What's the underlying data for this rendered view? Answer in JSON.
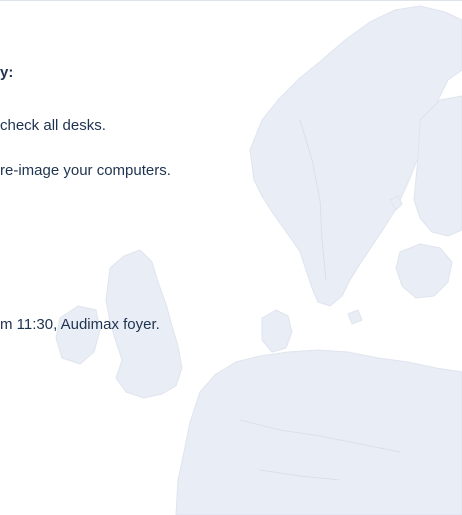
{
  "message": {
    "heading": "y:",
    "lines": [
      "check all desks.",
      "re-image your computers.",
      "m 11:30, Audimax foyer."
    ]
  },
  "colors": {
    "text": "#1e3350",
    "map_fill": "#e8ecf4",
    "map_stroke": "#dce2ec",
    "background": "#ffffff"
  },
  "icons": {
    "background": "europe-map-icon"
  }
}
